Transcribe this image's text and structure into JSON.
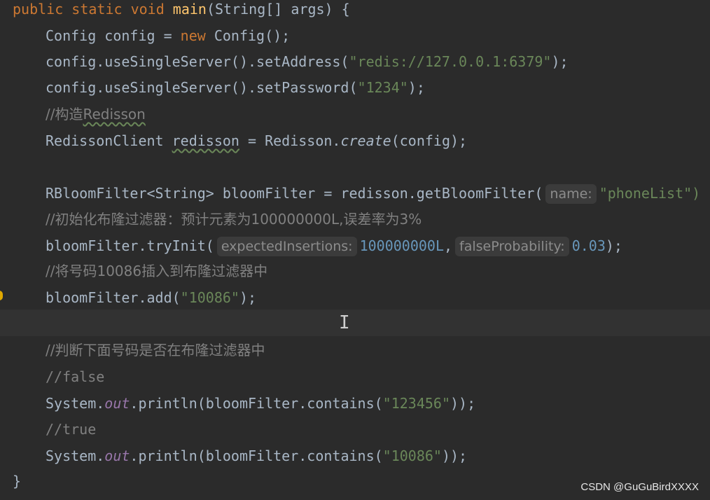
{
  "code": {
    "l1": {
      "kw": "public static void",
      "fn": "main",
      "rest": "(String[] args) {"
    },
    "l2": {
      "pre": "Config config = ",
      "kw": "new",
      "post": " Config();"
    },
    "l3": {
      "pre": "config.useSingleServer().setAddress(",
      "str": "\"redis://127.0.0.1:6379\"",
      "post": ");"
    },
    "l4": {
      "pre": "config.useSingleServer().setPassword(",
      "str": "\"1234\"",
      "post": ");"
    },
    "l5": {
      "cmt": "//构造",
      "cmt_wavy": "Redisson"
    },
    "l6": {
      "pre": "RedissonClient ",
      "var": "redisson",
      "mid": " = Redisson.",
      "it": "create",
      "post": "(config);"
    },
    "l7": {
      "pre": "RBloomFilter<String> bloomFilter = redisson.getBloomFilter(",
      "hint": "name:",
      "str": "\"phoneList\")"
    },
    "l8": {
      "cmt": "//初始化布隆过滤器：预计元素为100000000L,误差率为3%"
    },
    "l9": {
      "pre": "bloomFilter.tryInit(",
      "hint1": "expectedInsertions:",
      "num1": "100000000L",
      "comma": ",",
      "hint2": "falseProbability:",
      "num2": "0.03",
      "post": ");"
    },
    "l10": {
      "cmt": "//将号码10086插入到布隆过滤器中"
    },
    "l11": {
      "pre": "bloomFilter.add(",
      "str": "\"10086\"",
      "post": ");"
    },
    "l13": {
      "cmt": "//判断下面号码是否在布隆过滤器中"
    },
    "l14": {
      "cmt": "//false"
    },
    "l15": {
      "pre": "System.",
      "st": "out",
      "mid": ".println(bloomFilter.contains(",
      "str": "\"123456\"",
      "post": "));"
    },
    "l16": {
      "cmt": "//true"
    },
    "l17": {
      "pre": "System.",
      "st": "out",
      "mid": ".println(bloomFilter.contains(",
      "str": "\"10086\"",
      "post": "));"
    },
    "l18": {
      "brace": "}"
    }
  },
  "watermark": "CSDN @GuGuBirdXXXX",
  "cursor_glyph": "I",
  "colors": {
    "background": "#2b2b2b",
    "keyword": "#cc7832",
    "string": "#6a8759",
    "number": "#6897bb",
    "comment": "#808080",
    "function": "#ffc66d"
  }
}
